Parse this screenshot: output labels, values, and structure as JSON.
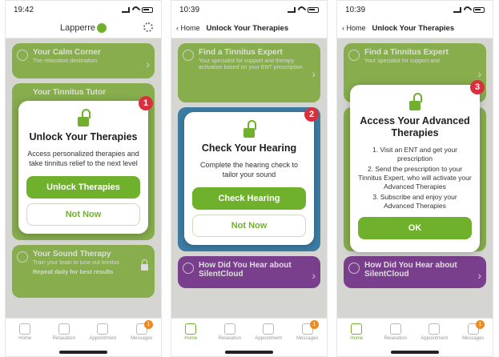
{
  "screens": [
    {
      "time": "19:42",
      "brand": "Lapperre",
      "cards": [
        {
          "title": "Your Calm Corner",
          "subtitle": "The relaxation destination"
        },
        {
          "title": "Your Tinnitus Tutor",
          "subtitle": ""
        },
        {
          "title": "Your Sound Therapy",
          "subtitle": "Train your brain to tune out tinnitus",
          "extra": "Repeat daily for best results"
        }
      ],
      "modal": {
        "step": "1",
        "title": "Unlock Your Therapies",
        "text": "Access personalized therapies and take tinnitus relief to the next level",
        "primary": "Unlock Therapies",
        "secondary": "Not Now"
      },
      "tabs": [
        {
          "label": "Home"
        },
        {
          "label": "Relaxation"
        },
        {
          "label": "Appointment"
        },
        {
          "label": "Messages",
          "badge": "1"
        }
      ]
    },
    {
      "time": "10:39",
      "back": "Home",
      "title": "Unlock Your Therapies",
      "cards": [
        {
          "title": "Find a Tinnitus Expert",
          "subtitle": "Your specialist for support and therapy activation based on your ENT prescription"
        },
        {
          "title": "How Did You Hear about SilentCloud",
          "subtitle": ""
        }
      ],
      "modal": {
        "step": "2",
        "title": "Check Your Hearing",
        "text": "Complete the hearing check to tailor your sound",
        "primary": "Check Hearing",
        "secondary": "Not Now"
      },
      "tabs": [
        {
          "label": "Home"
        },
        {
          "label": "Relaxation"
        },
        {
          "label": "Appointment"
        },
        {
          "label": "Messages",
          "badge": "1"
        }
      ]
    },
    {
      "time": "10:39",
      "back": "Home",
      "title": "Unlock Your Therapies",
      "cards": [
        {
          "title": "Find a Tinnitus Expert",
          "subtitle": "Your specialist for support and"
        },
        {
          "title": "How Did You Hear about SilentCloud",
          "subtitle": ""
        }
      ],
      "modal": {
        "step": "3",
        "title": "Access Your Advanced Therapies",
        "items": [
          "1. Visit an ENT and get your prescription",
          "2. Send the prescription to your Tinnitus Expert, who will activate your Advanced Therapies",
          "3. Subscribe and enjoy your Advanced Therapies"
        ],
        "primary": "OK"
      },
      "tabs": [
        {
          "label": "Home"
        },
        {
          "label": "Relaxation"
        },
        {
          "label": "Appointment"
        },
        {
          "label": "Messages",
          "badge": "1"
        }
      ]
    }
  ]
}
